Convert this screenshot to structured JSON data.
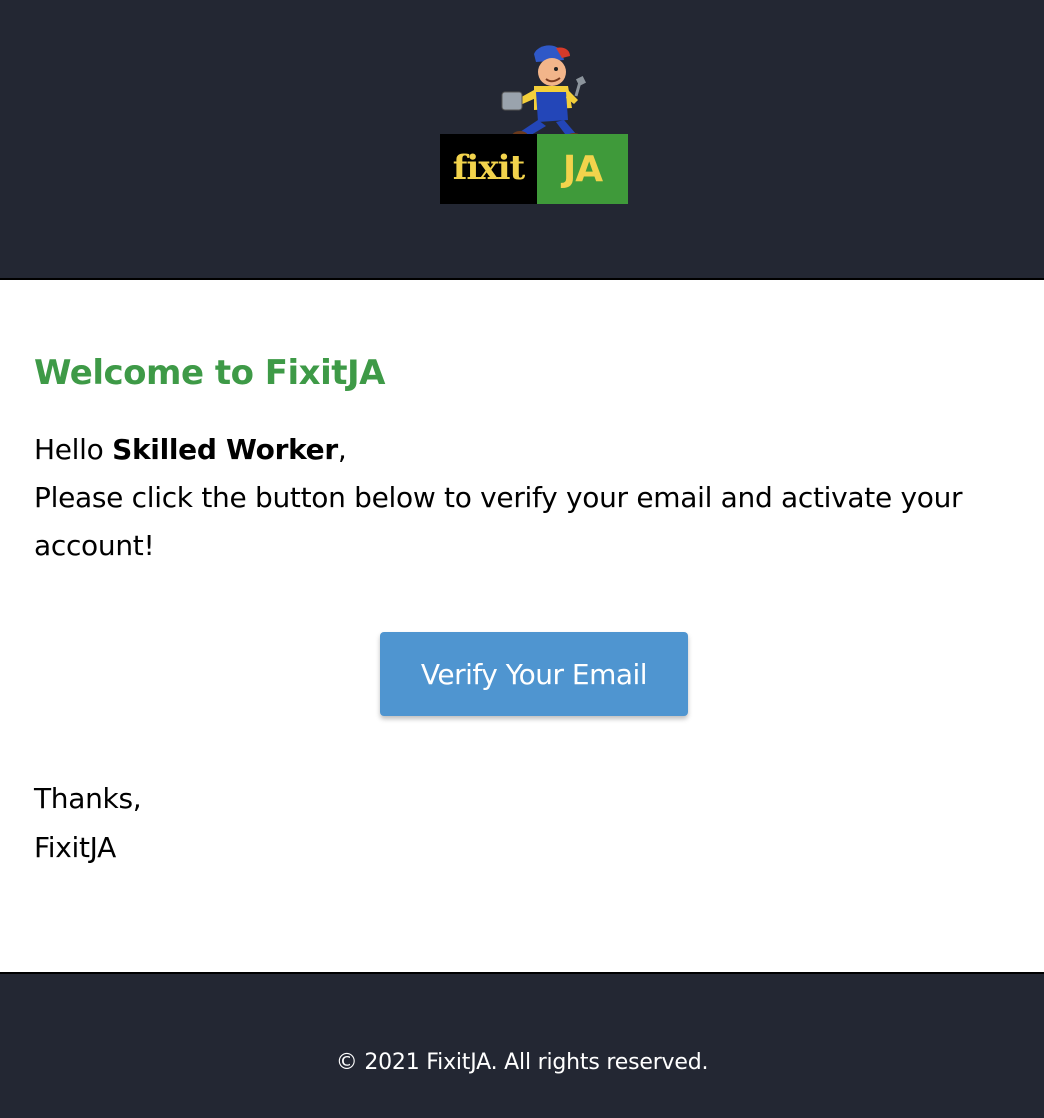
{
  "header": {
    "logo": {
      "text_fixit": "fixit",
      "text_ja": "JA",
      "colors": {
        "fixit_background": "#000000",
        "ja_background": "#3f9a3a",
        "lettering": "#f2d34c"
      }
    },
    "background_color": "#232733"
  },
  "content": {
    "title": "Welcome to FixitJA",
    "greeting_prefix": "Hello ",
    "recipient_name": "Skilled Worker",
    "greeting_suffix": ",",
    "body": "Please click the button below to verify your email and activate your account!",
    "verify_button_label": "Verify Your Email",
    "signoff_line1": "Thanks,",
    "signoff_line2": "FixitJA",
    "colors": {
      "title": "#3e9a47",
      "button": "#4f95d0"
    }
  },
  "footer": {
    "copyright": "© 2021 FixitJA. All rights reserved."
  }
}
